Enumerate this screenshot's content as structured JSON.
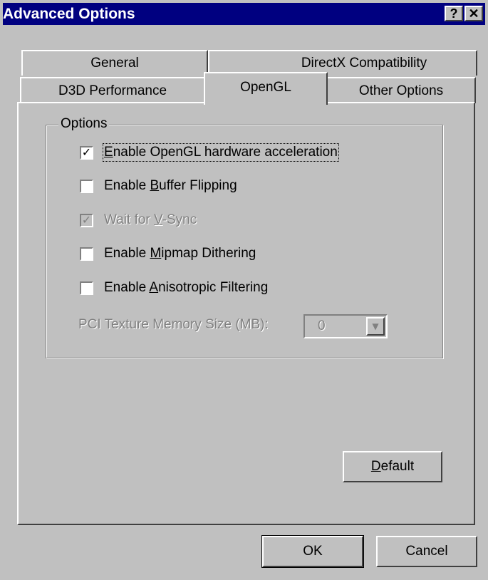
{
  "window": {
    "title": "Advanced Options",
    "help_label": "?",
    "close_label": "✕"
  },
  "tabs": {
    "row_back": [
      {
        "label": "General"
      },
      {
        "label": "DirectX Compatibility"
      }
    ],
    "row_front": [
      {
        "label": "D3D Performance"
      },
      {
        "label": "OpenGL",
        "selected": true
      },
      {
        "label": "Other Options"
      }
    ]
  },
  "options": {
    "group_label": "Options",
    "checkboxes": [
      {
        "prefix": "",
        "mnemonic": "E",
        "suffix": "nable OpenGL hardware acceleration",
        "checked": true,
        "enabled": true,
        "focused": true
      },
      {
        "prefix": "Enable ",
        "mnemonic": "B",
        "suffix": "uffer Flipping",
        "checked": false,
        "enabled": true
      },
      {
        "prefix": "Wait for ",
        "mnemonic": "V",
        "suffix": "-Sync",
        "checked": true,
        "enabled": false
      },
      {
        "prefix": "Enable ",
        "mnemonic": "M",
        "suffix": "ipmap Dithering",
        "checked": false,
        "enabled": true
      },
      {
        "prefix": "Enable ",
        "mnemonic": "A",
        "suffix": "nisotropic Filtering",
        "checked": false,
        "enabled": true
      }
    ],
    "texture_memory": {
      "label": "PCI Texture Memory Size (MB):",
      "value": "0",
      "enabled": false
    }
  },
  "buttons": {
    "default_mnemonic": "D",
    "default_rest": "efault",
    "ok": "OK",
    "cancel": "Cancel"
  },
  "colors": {
    "face": "#c0c0c0",
    "title_bar": "#000080",
    "disabled_text": "#808080"
  }
}
